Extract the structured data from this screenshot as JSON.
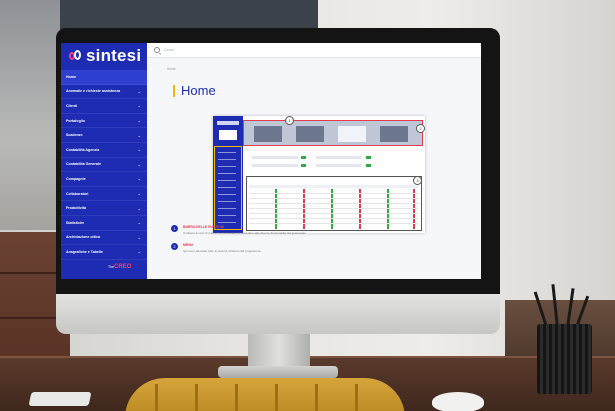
{
  "app": {
    "brand": "sintesi",
    "search_placeholder": "Cerca",
    "breadcrumb": "Home",
    "page_title": "Home",
    "footer_logo_prefix": "The",
    "footer_logo_main": "CREO"
  },
  "sidebar": {
    "items": [
      {
        "label": "Home",
        "active": true,
        "chevron": false
      },
      {
        "label": "Anomalie e richieste assistenza",
        "active": false,
        "chevron": true
      },
      {
        "label": "Clienti",
        "active": false,
        "chevron": true
      },
      {
        "label": "Portafoglio",
        "active": false,
        "chevron": true
      },
      {
        "label": "Scadenze",
        "active": false,
        "chevron": true
      },
      {
        "label": "Contabilità Agenzia",
        "active": false,
        "chevron": true
      },
      {
        "label": "Contabilità Generale",
        "active": false,
        "chevron": true
      },
      {
        "label": "Compagnie",
        "active": false,
        "chevron": true
      },
      {
        "label": "Collaboratori",
        "active": false,
        "chevron": true
      },
      {
        "label": "Produttività",
        "active": false,
        "chevron": true
      },
      {
        "label": "Statistiche",
        "active": false,
        "chevron": true
      },
      {
        "label": "Archiviazione ottica",
        "active": false,
        "chevron": true
      },
      {
        "label": "Anagrafiche e Tabelle",
        "active": false,
        "chevron": true
      }
    ]
  },
  "legend": [
    {
      "number": "1",
      "title": "BARRA DELLE FUNZIONI",
      "description": "Contiene le voci di menu che permettono di accedere alle diverse funzionalità del gestionale."
    },
    {
      "number": "2",
      "title": "MENU",
      "description": "Qui sono elencate tutte le sezioni di lavoro del programma."
    }
  ],
  "mini_badges": [
    "1",
    "2",
    "3"
  ],
  "colors": {
    "brand_blue": "#1d2cb3",
    "accent_yellow": "#f5b800",
    "accent_red": "#e23b4e",
    "accent_pink": "#ff3b7f"
  }
}
